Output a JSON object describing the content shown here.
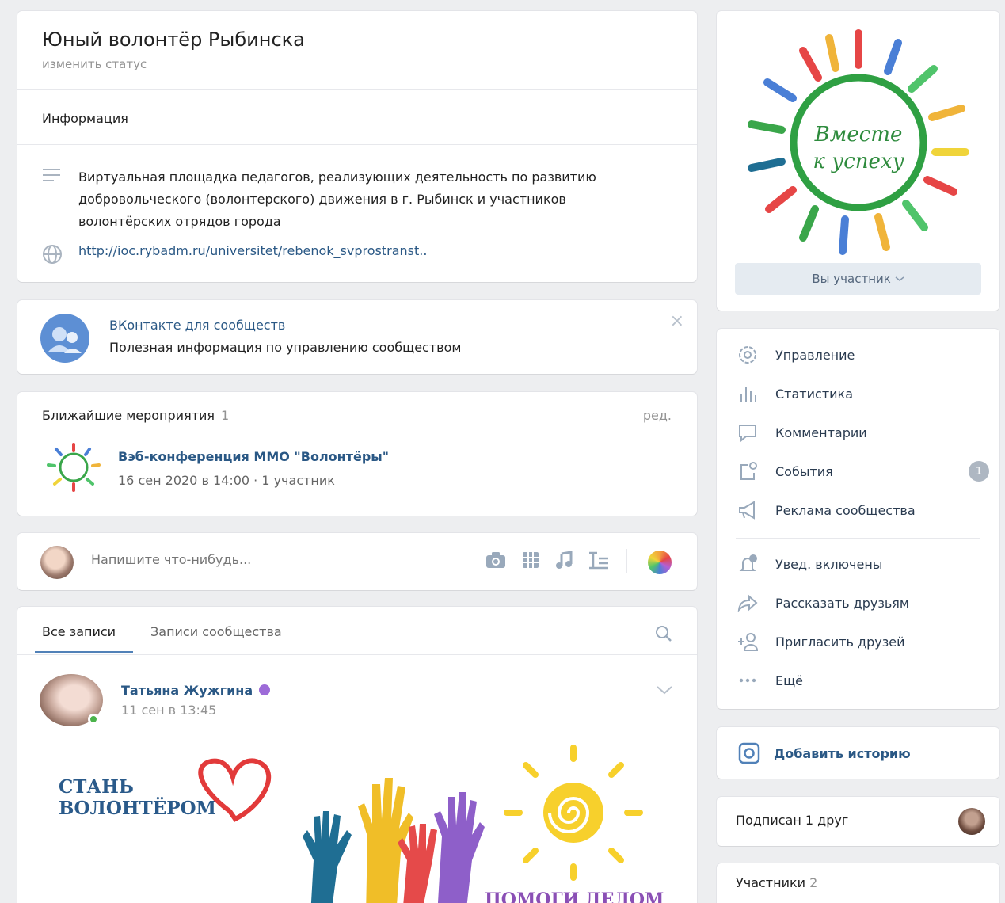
{
  "header": {
    "title": "Юный волонтёр Рыбинска",
    "status": "изменить статус",
    "info_heading": "Информация",
    "description": "Виртуальная площадка педагогов, реализующих деятельность по развитию добровольческого (волонтерского) движения в г. Рыбинск и участников волонтёрских отрядов города",
    "website": "http://ioc.rybadm.ru/universitet/rebenok_svprostranst.."
  },
  "promo": {
    "title": "ВКонтакте для сообществ",
    "text": "Полезная информация по управлению сообществом",
    "close": "×"
  },
  "events": {
    "heading": "Ближайшие мероприятия",
    "count": "1",
    "edit": "ред.",
    "item_title": "Вэб-конференция ММО \"Волонтёры\"",
    "item_meta": "16 сен 2020 в 14:00 · 1 участник"
  },
  "composer": {
    "placeholder": "Напишите что-нибудь..."
  },
  "wall": {
    "tabs": [
      "Все записи",
      "Записи сообщества"
    ],
    "post": {
      "author": "Татьяна Жужгина",
      "date": "11 сен в 13:45",
      "image_text_1": "СТАНЬ",
      "image_text_2": "ВОЛОНТЁРОМ",
      "image_text_3": "ПОМОГИ ДЕЛОМ"
    }
  },
  "cover": {
    "text_1": "Вместе",
    "text_2": "к успеху",
    "member_button": "Вы участник"
  },
  "menu": {
    "items": [
      {
        "label": "Управление",
        "icon": "gear-icon"
      },
      {
        "label": "Статистика",
        "icon": "stats-icon"
      },
      {
        "label": "Комментарии",
        "icon": "comment-icon"
      },
      {
        "label": "События",
        "icon": "events-icon",
        "badge": "1"
      },
      {
        "label": "Реклама сообщества",
        "icon": "megaphone-icon"
      },
      {
        "label": "Увед. включены",
        "icon": "bell-icon"
      },
      {
        "label": "Рассказать друзьям",
        "icon": "share-icon"
      },
      {
        "label": "Пригласить друзей",
        "icon": "invite-icon"
      },
      {
        "label": "Ещё",
        "icon": "more-icon"
      }
    ]
  },
  "story": {
    "label": "Добавить историю"
  },
  "friends": {
    "label": "Подписан 1 друг"
  },
  "members": {
    "label": "Участники",
    "count": "2"
  },
  "colors": {
    "link": "#2a5885",
    "accent": "#5181b8",
    "bg": "#edeef0"
  }
}
